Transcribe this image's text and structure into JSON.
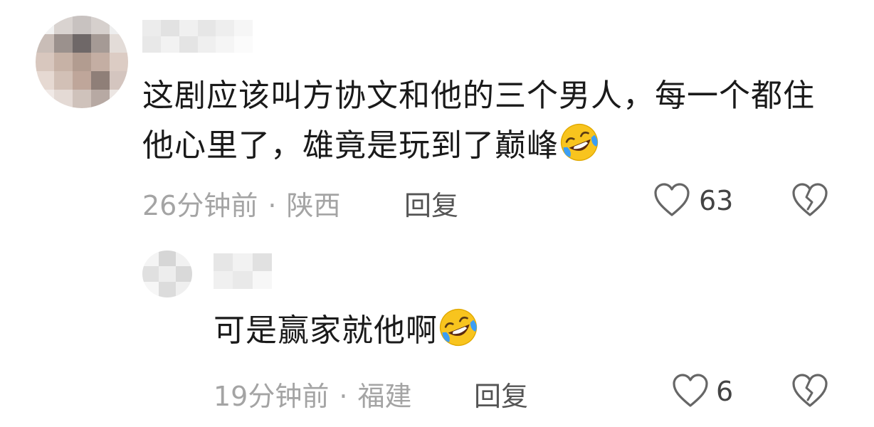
{
  "comment": {
    "text": "这剧应该叫方协文和他的三个男人，每一个都住他心里了，雄竟是玩到了巅峰",
    "emoji": "rofl-emoji",
    "time": "26分钟前",
    "separator": "·",
    "location": "陕西",
    "reply_label": "回复",
    "likes": "63",
    "like_icon": "heart-outline-icon",
    "dislike_icon": "broken-heart-icon"
  },
  "reply": {
    "text": "可是赢家就他啊",
    "emoji": "rofl-emoji",
    "time": "19分钟前",
    "separator": "·",
    "location": "福建",
    "reply_label": "回复",
    "likes": "6",
    "like_icon": "heart-outline-icon",
    "dislike_icon": "broken-heart-icon"
  },
  "colors": {
    "text": "#1a1a1a",
    "meta": "#a4a4a4",
    "icon": "#666666",
    "emoji_face": "#f8c41e",
    "emoji_tear": "#3b9ef5"
  }
}
